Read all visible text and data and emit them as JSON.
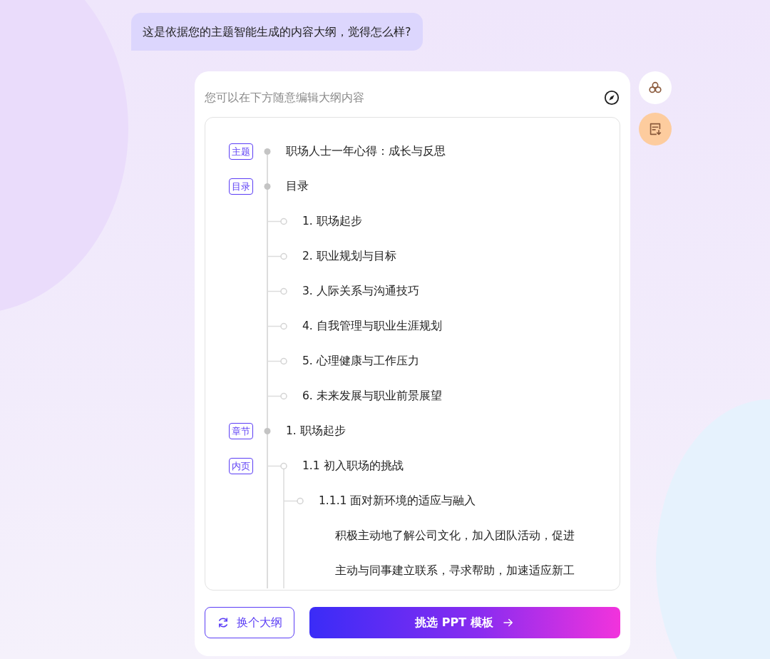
{
  "message": "这是依据您的主题智能生成的内容大纲，觉得怎么样?",
  "editor": {
    "hint": "您可以在下方随意编辑大纲内容"
  },
  "outline": [
    {
      "tag": "主题",
      "text": "职场人士一年心得：成长与反思"
    },
    {
      "tag": "目录",
      "text": "目录",
      "children": [
        {
          "text": "1. 职场起步"
        },
        {
          "text": "2. 职业规划与目标"
        },
        {
          "text": "3. 人际关系与沟通技巧"
        },
        {
          "text": "4. 自我管理与职业生涯规划"
        },
        {
          "text": "5. 心理健康与工作压力"
        },
        {
          "text": "6. 未来发展与职业前景展望"
        }
      ]
    },
    {
      "tag": "章节",
      "text": "1. 职场起步",
      "children": [
        {
          "tag": "内页",
          "text": "1.1 初入职场的挑战",
          "children": [
            {
              "text": "1.1.1 面对新环境的适应与融入",
              "children": [
                {
                  "text": "积极主动地了解公司文化，加入团队活动，促进"
                },
                {
                  "text": "主动与同事建立联系，寻求帮助，加速适应新工"
                }
              ]
            }
          ]
        }
      ]
    }
  ],
  "buttons": {
    "secondary": "换个大纲",
    "primary": "挑选 PPT 模板"
  }
}
